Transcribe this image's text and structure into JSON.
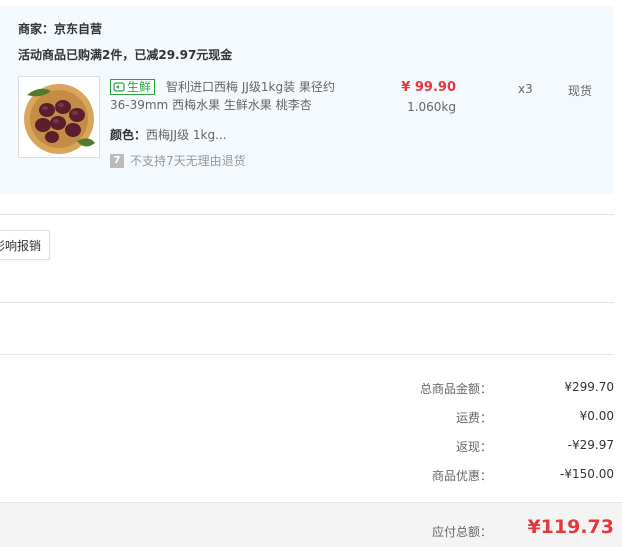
{
  "shop": {
    "merchant_label": "商家：京东自营",
    "promo": "活动商品已购满2件，已减29.97元现金"
  },
  "product": {
    "badge": "生鲜",
    "title": "智利进口西梅 JJ级1kg装 果径约36-39mm 西梅水果 生鲜水果 桃李杏",
    "price": "¥ 99.90",
    "weight": "1.060kg",
    "quantity": "x3",
    "stock": "现货",
    "attr_label": "颜色：",
    "attr_value": "西梅JJ级 1kg...",
    "return_icon": "7",
    "return_policy": "不支持7天无理由退货",
    "badge_color": "#2aa43e",
    "price_color": "#e4393c"
  },
  "invoice": {
    "button_label": "影响报销"
  },
  "summary": {
    "rows": [
      {
        "label": "总商品金额：",
        "value": "¥299.70"
      },
      {
        "label": "运费：",
        "value": "¥0.00"
      },
      {
        "label": "返现：",
        "value": "-¥29.97"
      },
      {
        "label": "商品优惠：",
        "value": "-¥150.00"
      }
    ],
    "total_label": "应付总额：",
    "total_value": "¥119.73"
  }
}
